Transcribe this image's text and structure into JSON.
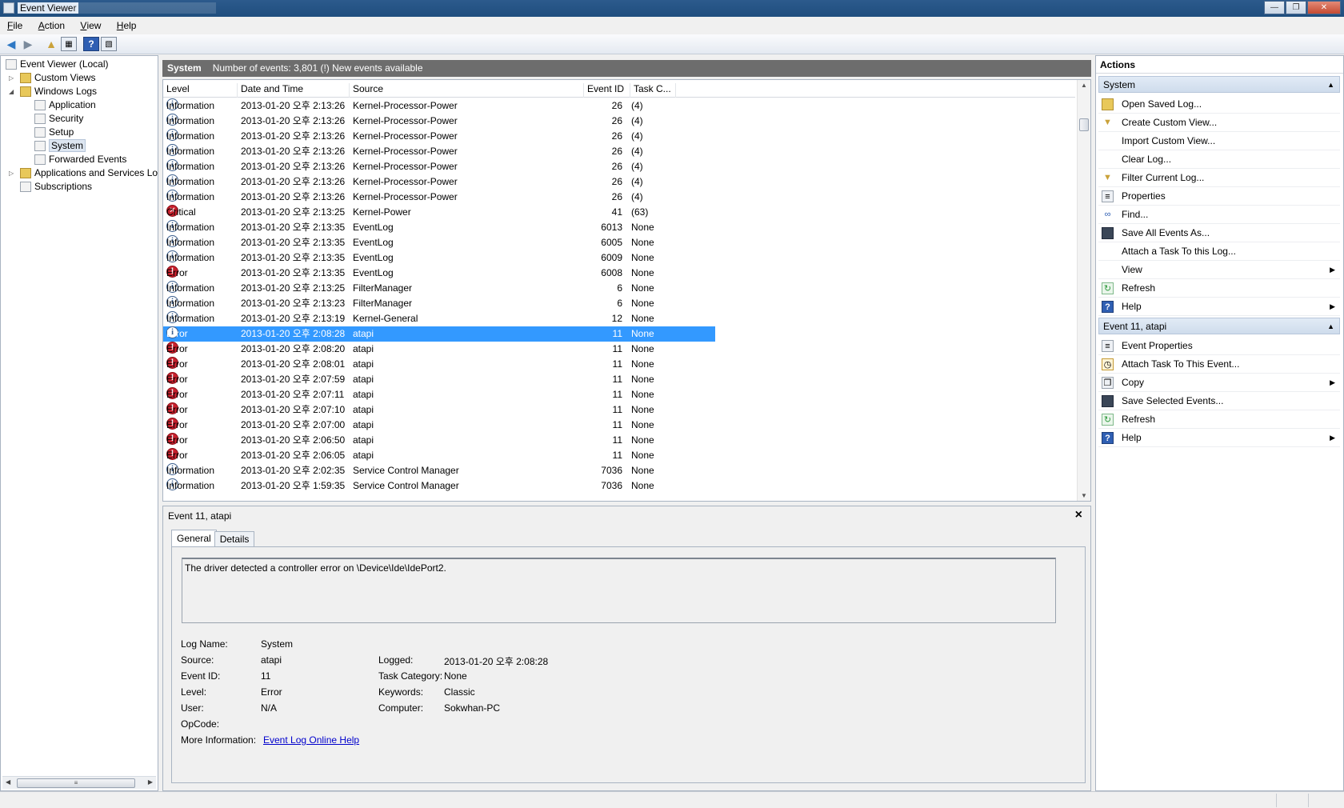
{
  "window": {
    "title": "Event Viewer",
    "min": "—",
    "max": "❐",
    "close": "✕"
  },
  "menu": [
    {
      "pre": "",
      "acc": "F",
      "post": "ile"
    },
    {
      "pre": "",
      "acc": "A",
      "post": "ction"
    },
    {
      "pre": "",
      "acc": "V",
      "post": "iew"
    },
    {
      "pre": "",
      "acc": "H",
      "post": "elp"
    }
  ],
  "tree": {
    "root": "Event Viewer (Local)",
    "custom_views": "Custom Views",
    "windows_logs": "Windows Logs",
    "application": "Application",
    "security": "Security",
    "setup": "Setup",
    "system": "System",
    "forwarded": "Forwarded Events",
    "apps_services": "Applications and Services Lo",
    "subscriptions": "Subscriptions"
  },
  "log_header": {
    "name": "System",
    "info": "Number of events: 3,801 (!) New events available"
  },
  "columns": {
    "level": "Level",
    "datetime": "Date and Time",
    "source": "Source",
    "event_id": "Event ID",
    "task": "Task C..."
  },
  "events": [
    {
      "kind": "info",
      "level": "Information",
      "dt": "2013-01-20 오후 2:13:26",
      "source": "Kernel-Processor-Power",
      "id": "26",
      "task": "(4)"
    },
    {
      "kind": "info",
      "level": "Information",
      "dt": "2013-01-20 오후 2:13:26",
      "source": "Kernel-Processor-Power",
      "id": "26",
      "task": "(4)"
    },
    {
      "kind": "info",
      "level": "Information",
      "dt": "2013-01-20 오후 2:13:26",
      "source": "Kernel-Processor-Power",
      "id": "26",
      "task": "(4)"
    },
    {
      "kind": "info",
      "level": "Information",
      "dt": "2013-01-20 오후 2:13:26",
      "source": "Kernel-Processor-Power",
      "id": "26",
      "task": "(4)"
    },
    {
      "kind": "info",
      "level": "Information",
      "dt": "2013-01-20 오후 2:13:26",
      "source": "Kernel-Processor-Power",
      "id": "26",
      "task": "(4)"
    },
    {
      "kind": "info",
      "level": "Information",
      "dt": "2013-01-20 오후 2:13:26",
      "source": "Kernel-Processor-Power",
      "id": "26",
      "task": "(4)"
    },
    {
      "kind": "info",
      "level": "Information",
      "dt": "2013-01-20 오후 2:13:26",
      "source": "Kernel-Processor-Power",
      "id": "26",
      "task": "(4)"
    },
    {
      "kind": "crit",
      "level": "Critical",
      "dt": "2013-01-20 오후 2:13:25",
      "source": "Kernel-Power",
      "id": "41",
      "task": "(63)"
    },
    {
      "kind": "info",
      "level": "Information",
      "dt": "2013-01-20 오후 2:13:35",
      "source": "EventLog",
      "id": "6013",
      "task": "None"
    },
    {
      "kind": "info",
      "level": "Information",
      "dt": "2013-01-20 오후 2:13:35",
      "source": "EventLog",
      "id": "6005",
      "task": "None"
    },
    {
      "kind": "info",
      "level": "Information",
      "dt": "2013-01-20 오후 2:13:35",
      "source": "EventLog",
      "id": "6009",
      "task": "None"
    },
    {
      "kind": "err",
      "level": "Error",
      "dt": "2013-01-20 오후 2:13:35",
      "source": "EventLog",
      "id": "6008",
      "task": "None"
    },
    {
      "kind": "info",
      "level": "Information",
      "dt": "2013-01-20 오후 2:13:25",
      "source": "FilterManager",
      "id": "6",
      "task": "None"
    },
    {
      "kind": "info",
      "level": "Information",
      "dt": "2013-01-20 오후 2:13:23",
      "source": "FilterManager",
      "id": "6",
      "task": "None"
    },
    {
      "kind": "info",
      "level": "Information",
      "dt": "2013-01-20 오후 2:13:19",
      "source": "Kernel-General",
      "id": "12",
      "task": "None"
    },
    {
      "kind": "info",
      "level": "Error",
      "dt": "2013-01-20 오후 2:08:28",
      "source": "atapi",
      "id": "11",
      "task": "None",
      "selected": true
    },
    {
      "kind": "err",
      "level": "Error",
      "dt": "2013-01-20 오후 2:08:20",
      "source": "atapi",
      "id": "11",
      "task": "None"
    },
    {
      "kind": "err",
      "level": "Error",
      "dt": "2013-01-20 오후 2:08:01",
      "source": "atapi",
      "id": "11",
      "task": "None"
    },
    {
      "kind": "err",
      "level": "Error",
      "dt": "2013-01-20 오후 2:07:59",
      "source": "atapi",
      "id": "11",
      "task": "None"
    },
    {
      "kind": "err",
      "level": "Error",
      "dt": "2013-01-20 오후 2:07:11",
      "source": "atapi",
      "id": "11",
      "task": "None"
    },
    {
      "kind": "err",
      "level": "Error",
      "dt": "2013-01-20 오후 2:07:10",
      "source": "atapi",
      "id": "11",
      "task": "None"
    },
    {
      "kind": "err",
      "level": "Error",
      "dt": "2013-01-20 오후 2:07:00",
      "source": "atapi",
      "id": "11",
      "task": "None"
    },
    {
      "kind": "err",
      "level": "Error",
      "dt": "2013-01-20 오후 2:06:50",
      "source": "atapi",
      "id": "11",
      "task": "None"
    },
    {
      "kind": "err",
      "level": "Error",
      "dt": "2013-01-20 오후 2:06:05",
      "source": "atapi",
      "id": "11",
      "task": "None"
    },
    {
      "kind": "info",
      "level": "Information",
      "dt": "2013-01-20 오후 2:02:35",
      "source": "Service Control Manager",
      "id": "7036",
      "task": "None"
    },
    {
      "kind": "info",
      "level": "Information",
      "dt": "2013-01-20 오후 1:59:35",
      "source": "Service Control Manager",
      "id": "7036",
      "task": "None"
    }
  ],
  "detail": {
    "title": "Event 11, atapi",
    "tab_general": "General",
    "tab_details": "Details",
    "message": "The driver detected a controller error on \\Device\\Ide\\IdePort2.",
    "labels": {
      "log_name": "Log Name:",
      "source": "Source:",
      "event_id": "Event ID:",
      "level": "Level:",
      "user": "User:",
      "opcode": "OpCode:",
      "more_info": "More Information:",
      "logged": "Logged:",
      "task_category": "Task Category:",
      "keywords": "Keywords:",
      "computer": "Computer:"
    },
    "values": {
      "log_name": "System",
      "source": "atapi",
      "event_id": "11",
      "level": "Error",
      "user": "N/A",
      "logged": "2013-01-20 오후 2:08:28",
      "task_category": "None",
      "keywords": "Classic",
      "computer": "Sokwhan-PC"
    },
    "link": "Event Log Online Help"
  },
  "actions": {
    "title": "Actions",
    "system_section": "System",
    "system_items": [
      {
        "label": "Open Saved Log...",
        "icon": "folder-open-icon",
        "sub": false
      },
      {
        "label": "Create Custom View...",
        "icon": "filter-icon",
        "sub": false
      },
      {
        "label": "Import Custom View...",
        "icon": "",
        "sub": false
      },
      {
        "label": "Clear Log...",
        "icon": "",
        "sub": false
      },
      {
        "label": "Filter Current Log...",
        "icon": "filter-icon",
        "sub": false
      },
      {
        "label": "Properties",
        "icon": "properties-icon",
        "sub": false
      },
      {
        "label": "Find...",
        "icon": "binoculars-icon",
        "sub": false
      },
      {
        "label": "Save All Events As...",
        "icon": "save-icon",
        "sub": false
      },
      {
        "label": "Attach a Task To this Log...",
        "icon": "",
        "sub": false
      },
      {
        "label": "View",
        "icon": "",
        "sub": true
      },
      {
        "label": "Refresh",
        "icon": "refresh-icon",
        "sub": false
      },
      {
        "label": "Help",
        "icon": "help-icon",
        "sub": true
      }
    ],
    "event_section": "Event 11, atapi",
    "event_items": [
      {
        "label": "Event Properties",
        "icon": "properties-icon",
        "sub": false
      },
      {
        "label": "Attach Task To This Event...",
        "icon": "task-icon",
        "sub": false
      },
      {
        "label": "Copy",
        "icon": "copy-icon",
        "sub": true
      },
      {
        "label": "Save Selected Events...",
        "icon": "save-icon",
        "sub": false
      },
      {
        "label": "Refresh",
        "icon": "refresh-icon",
        "sub": false
      },
      {
        "label": "Help",
        "icon": "help-icon",
        "sub": true
      }
    ]
  }
}
